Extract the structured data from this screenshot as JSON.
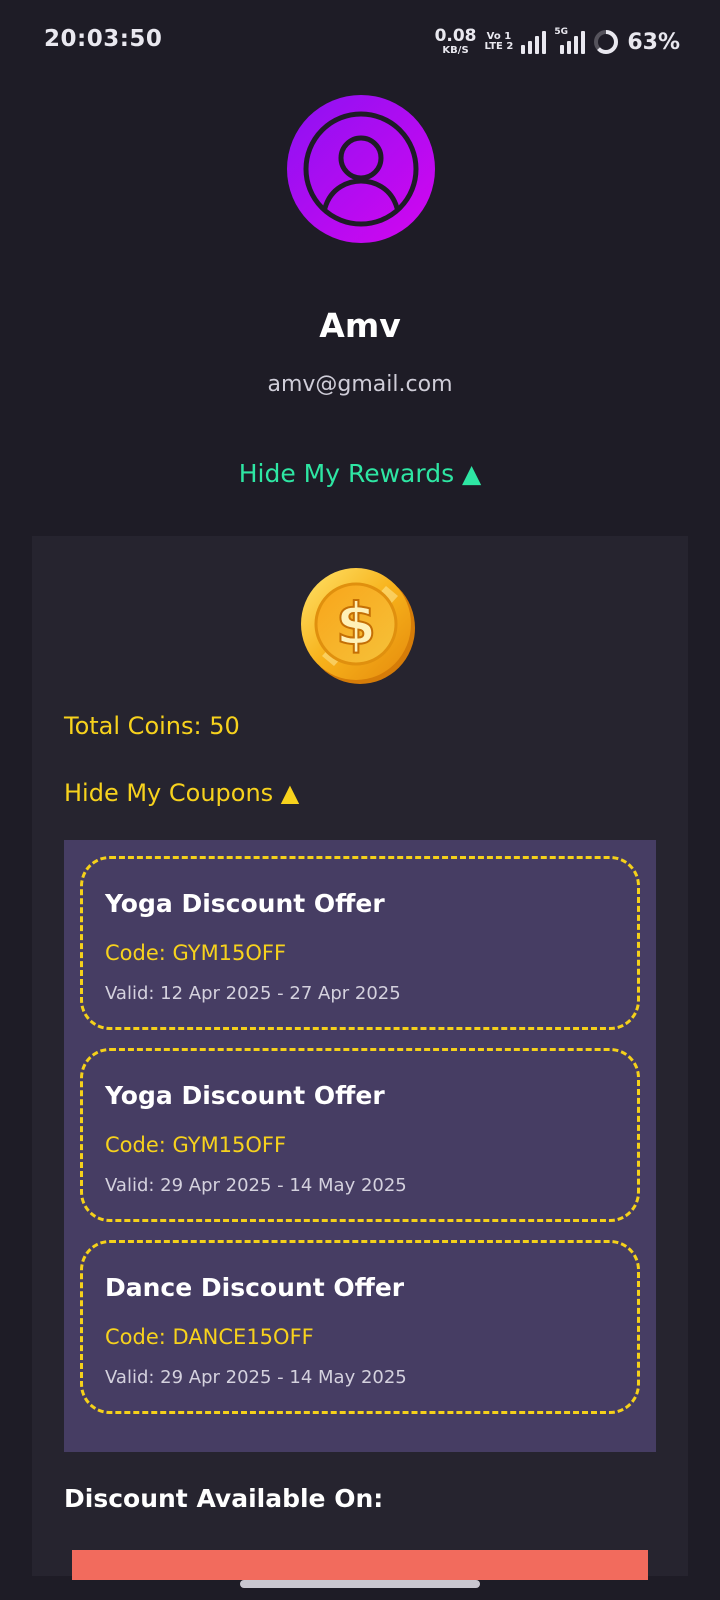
{
  "status_bar": {
    "time": "20:03:50",
    "net_speed_value": "0.08",
    "net_speed_unit": "KB/S",
    "volte_top": "Vo 1",
    "volte_bottom": "LTE 2",
    "five_g_label": "5G",
    "battery_percent": "63%",
    "battery_level": 0.63,
    "icons": [
      "signal-icon",
      "5g-signal-icon",
      "battery-icon"
    ]
  },
  "profile": {
    "avatar_icon": "user-avatar-icon",
    "name": "Amv",
    "email": "amv@gmail.com",
    "rewards_toggle_label": "Hide My Rewards ▲"
  },
  "rewards": {
    "coin_icon": "gold-coin-icon",
    "total_coins_label": "Total Coins: 50",
    "coupons_toggle_label": "Hide My Coupons ▲",
    "coupons": [
      {
        "title": "Yoga Discount Offer",
        "code": "Code: GYM15OFF",
        "valid": "Valid: 12 Apr 2025 - 27 Apr 2025"
      },
      {
        "title": "Yoga Discount Offer",
        "code": "Code: GYM15OFF",
        "valid": "Valid: 29 Apr 2025 - 14 May 2025"
      },
      {
        "title": "Dance Discount Offer",
        "code": "Code: DANCE15OFF",
        "valid": "Valid: 29 Apr 2025 - 14 May 2025"
      }
    ],
    "discount_heading": "Discount Available On:"
  },
  "colors": {
    "background": "#1e1c26",
    "panel": "#26242f",
    "coupon_box": "#463d63",
    "accent_green": "#2ee6a3",
    "accent_yellow": "#f7d21d",
    "avatar_purple": "#b60cf5",
    "discount_bar": "#f26b5d"
  }
}
